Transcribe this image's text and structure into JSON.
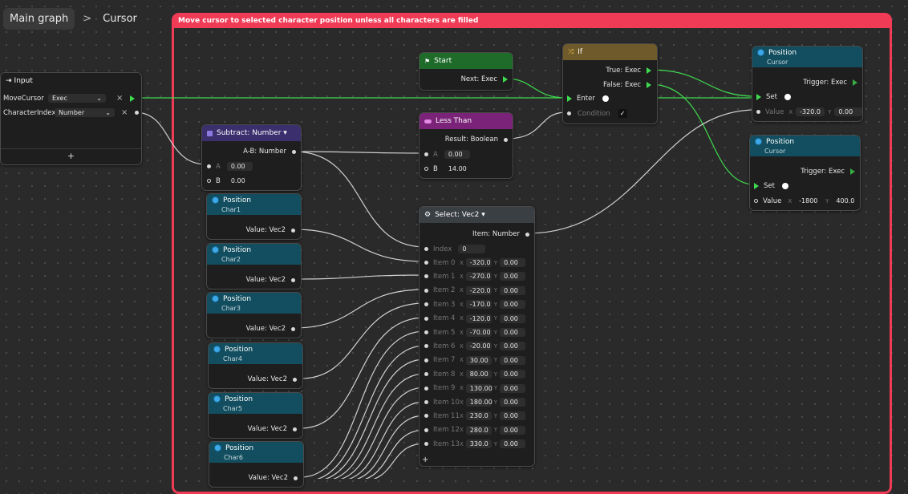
{
  "breadcrumb": {
    "root": "Main graph",
    "separator": ">",
    "current": "Cursor"
  },
  "group": {
    "title": "Move cursor to selected character position unless all characters are filled"
  },
  "input_node": {
    "title": "Input",
    "rows": [
      {
        "name": "MoveCursor",
        "type": "Exec"
      },
      {
        "name": "CharacterIndex",
        "type": "Number"
      }
    ],
    "add": "+"
  },
  "subtract": {
    "title": "Subtract: Number ▾",
    "out": "A-B: Number",
    "a_label": "A",
    "a_value": "0.00",
    "b_label": "B",
    "b_value": "0.00"
  },
  "start": {
    "title": "Start",
    "out": "Next: Exec"
  },
  "less_than": {
    "title": "Less Than",
    "out": "Result: Boolean",
    "a_label": "A",
    "a_value": "0.00",
    "b_label": "B",
    "b_value": "14.00"
  },
  "if_node": {
    "title": "If",
    "true": "True: Exec",
    "false": "False: Exec",
    "enter": "Enter",
    "condition": "Condition",
    "check": "✓"
  },
  "pos_top": {
    "title": "Position",
    "sub": "Cursor",
    "trigger": "Trigger: Exec",
    "set": "Set",
    "value": "Value",
    "x_label": "X",
    "x": "-320.0",
    "y_label": "Y",
    "y": "0.00"
  },
  "pos_bot": {
    "title": "Position",
    "sub": "Cursor",
    "trigger": "Trigger: Exec",
    "set": "Set",
    "value": "Value",
    "x_label": "X",
    "x": "-1800",
    "y_label": "Y",
    "y": "400.0"
  },
  "chars": [
    {
      "title": "Position",
      "sub": "Char1",
      "out": "Value: Vec2"
    },
    {
      "title": "Position",
      "sub": "Char2",
      "out": "Value: Vec2"
    },
    {
      "title": "Position",
      "sub": "Char3",
      "out": "Value: Vec2"
    },
    {
      "title": "Position",
      "sub": "Char4",
      "out": "Value: Vec2"
    },
    {
      "title": "Position",
      "sub": "Char5",
      "out": "Value: Vec2"
    },
    {
      "title": "Position",
      "sub": "Char6",
      "out": "Value: Vec2"
    }
  ],
  "select": {
    "title": "Select: Vec2 ▾",
    "out": "Item: Number",
    "index_label": "Index",
    "index_value": "0",
    "items": [
      {
        "label": "Item 0",
        "x": "-320.0",
        "y": "0.00"
      },
      {
        "label": "Item 1",
        "x": "-270.0",
        "y": "0.00"
      },
      {
        "label": "Item 2",
        "x": "-220.0",
        "y": "0.00"
      },
      {
        "label": "Item 3",
        "x": "-170.0",
        "y": "0.00"
      },
      {
        "label": "Item 4",
        "x": "-120.0",
        "y": "0.00"
      },
      {
        "label": "Item 5",
        "x": "-70.00",
        "y": "0.00"
      },
      {
        "label": "Item 6",
        "x": "-20.00",
        "y": "0.00"
      },
      {
        "label": "Item 7",
        "x": "30.00",
        "y": "0.00"
      },
      {
        "label": "Item 8",
        "x": "80.00",
        "y": "0.00"
      },
      {
        "label": "Item 9",
        "x": "130.00",
        "y": "0.00"
      },
      {
        "label": "Item 10",
        "x": "180.00",
        "y": "0.00"
      },
      {
        "label": "Item 11",
        "x": "230.0",
        "y": "0.00"
      },
      {
        "label": "Item 12",
        "x": "280.0",
        "y": "0.00"
      },
      {
        "label": "Item 13",
        "x": "330.0",
        "y": "0.00"
      }
    ],
    "axis_x": "X",
    "axis_y": "Y",
    "add": "+"
  },
  "colors": {
    "group": "#ef3b55",
    "start": "#1f6b2a",
    "compare": "#7a2378",
    "if": "#6e5a2a",
    "math": "#3c2f6e",
    "position": "#124e5f",
    "select": "#3a3f44",
    "exec_wire": "#3fdc4f"
  }
}
